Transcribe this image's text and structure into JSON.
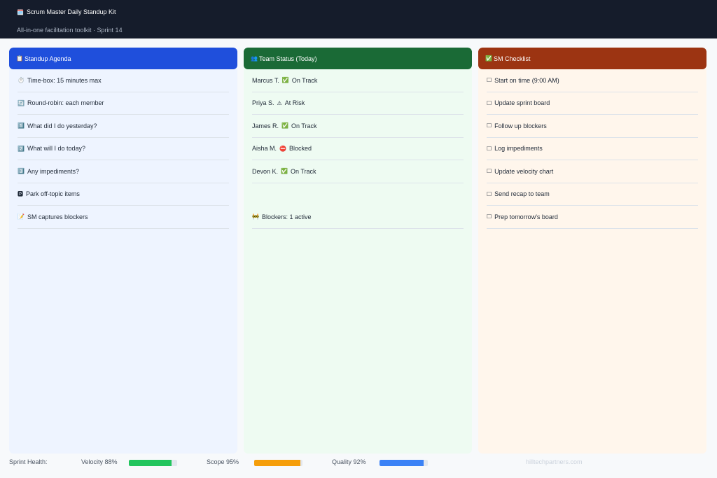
{
  "header": {
    "title_icon": "🗓️",
    "title": "Scrum Master Daily Standup Kit",
    "subtitle": "All-in-one facilitation toolkit · Sprint 14"
  },
  "colors": {
    "header_bg": "#151c2b",
    "agenda_accent": "#1f4fdc",
    "status_accent": "#1a6a36",
    "checklist_accent": "#9c3412"
  },
  "agenda": {
    "icon": "📋",
    "title": "Standup Agenda",
    "items": [
      {
        "icon": "⏱️",
        "text": "Time-box: 15 minutes max"
      },
      {
        "icon": "🔄",
        "text": "Round-robin: each member"
      },
      {
        "icon": "1️⃣",
        "text": "What did I do yesterday?"
      },
      {
        "icon": "2️⃣",
        "text": "What will I do today?"
      },
      {
        "icon": "3️⃣",
        "text": "Any impediments?"
      },
      {
        "icon": "🅿",
        "text": "Park off-topic items"
      },
      {
        "icon": "📝",
        "text": "SM captures blockers"
      }
    ]
  },
  "status": {
    "icon": "👥",
    "title": "Team Status (Today)",
    "members": [
      {
        "name": "Marcus T.",
        "icon": "✅",
        "state": "On Track"
      },
      {
        "name": "Priya S.",
        "icon": "⚠",
        "state": "At Risk"
      },
      {
        "name": "James R.",
        "icon": "✅",
        "state": "On Track"
      },
      {
        "name": "Aisha M.",
        "icon": "⛔",
        "state": "Blocked"
      },
      {
        "name": "Devon K.",
        "icon": "✅",
        "state": "On Track"
      }
    ],
    "blockers_icon": "🚧",
    "blockers": "Blockers: 1 active"
  },
  "checklist": {
    "icon": "✅",
    "title": "SM Checklist",
    "items": [
      {
        "icon": "☐",
        "text": "Start on time (9:00 AM)"
      },
      {
        "icon": "☐",
        "text": "Update sprint board"
      },
      {
        "icon": "☐",
        "text": "Follow up blockers"
      },
      {
        "icon": "☐",
        "text": "Log impediments"
      },
      {
        "icon": "☐",
        "text": "Update velocity chart"
      },
      {
        "icon": "☐",
        "text": "Send recap to team"
      },
      {
        "icon": "☐",
        "text": "Prep tomorrow's board"
      }
    ]
  },
  "footer": {
    "label": "Sprint Health:",
    "metrics": [
      {
        "label": "Velocity 88%",
        "value": 0.88,
        "color": "#22c55e"
      },
      {
        "label": "Scope 95%",
        "value": 0.95,
        "color": "#f59e0b"
      },
      {
        "label": "Quality 92%",
        "value": 0.92,
        "color": "#3b82f6"
      }
    ],
    "credit": "hilltechpartners.com"
  }
}
